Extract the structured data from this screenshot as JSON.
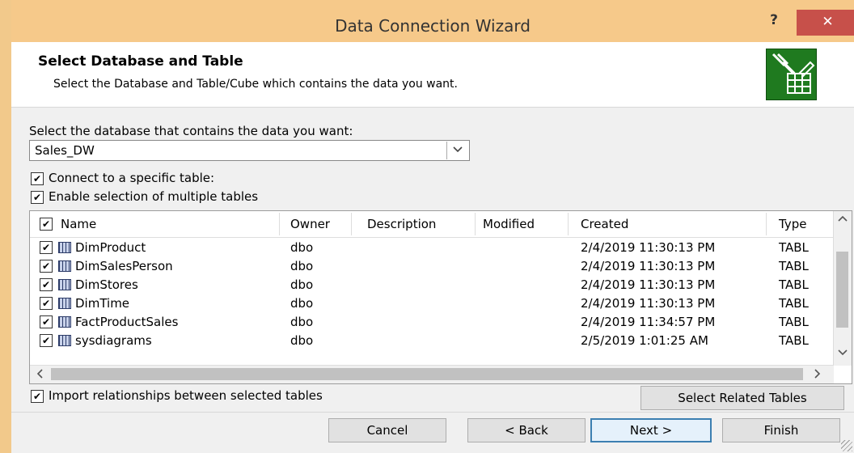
{
  "window": {
    "title": "Data Connection Wizard",
    "help_label": "?",
    "close_label": "✕"
  },
  "header": {
    "title": "Select Database and Table",
    "subtitle": "Select the Database and Table/Cube which contains the data you want.",
    "icon": "database-connection-icon"
  },
  "database": {
    "prompt": "Select the database that contains the data you want:",
    "selected": "Sales_DW",
    "dropdown_icon": "chevron-down-icon"
  },
  "options": {
    "connect_specific": {
      "label": "Connect to a specific table:",
      "checked": true
    },
    "enable_multiple": {
      "label": "Enable selection of multiple tables",
      "checked": true
    },
    "import_relationships": {
      "label": "Import relationships between selected tables",
      "checked": true
    }
  },
  "table": {
    "columns": [
      "Name",
      "Owner",
      "Description",
      "Modified",
      "Created",
      "Type"
    ],
    "header_checked": true,
    "rows": [
      {
        "name": "DimProduct",
        "owner": "dbo",
        "description": "",
        "modified": "",
        "created": "2/4/2019 11:30:13 PM",
        "type": "TABL",
        "checked": true
      },
      {
        "name": "DimSalesPerson",
        "owner": "dbo",
        "description": "",
        "modified": "",
        "created": "2/4/2019 11:30:13 PM",
        "type": "TABL",
        "checked": true
      },
      {
        "name": "DimStores",
        "owner": "dbo",
        "description": "",
        "modified": "",
        "created": "2/4/2019 11:30:13 PM",
        "type": "TABL",
        "checked": true
      },
      {
        "name": "DimTime",
        "owner": "dbo",
        "description": "",
        "modified": "",
        "created": "2/4/2019 11:30:13 PM",
        "type": "TABL",
        "checked": true
      },
      {
        "name": "FactProductSales",
        "owner": "dbo",
        "description": "",
        "modified": "",
        "created": "2/4/2019 11:34:57 PM",
        "type": "TABL",
        "checked": true
      },
      {
        "name": "sysdiagrams",
        "owner": "dbo",
        "description": "",
        "modified": "",
        "created": "2/5/2019 1:01:25 AM",
        "type": "TABL",
        "checked": true
      }
    ]
  },
  "buttons": {
    "select_related": "Select Related Tables",
    "cancel": "Cancel",
    "back": "< Back",
    "next": "Next >",
    "finish": "Finish"
  }
}
